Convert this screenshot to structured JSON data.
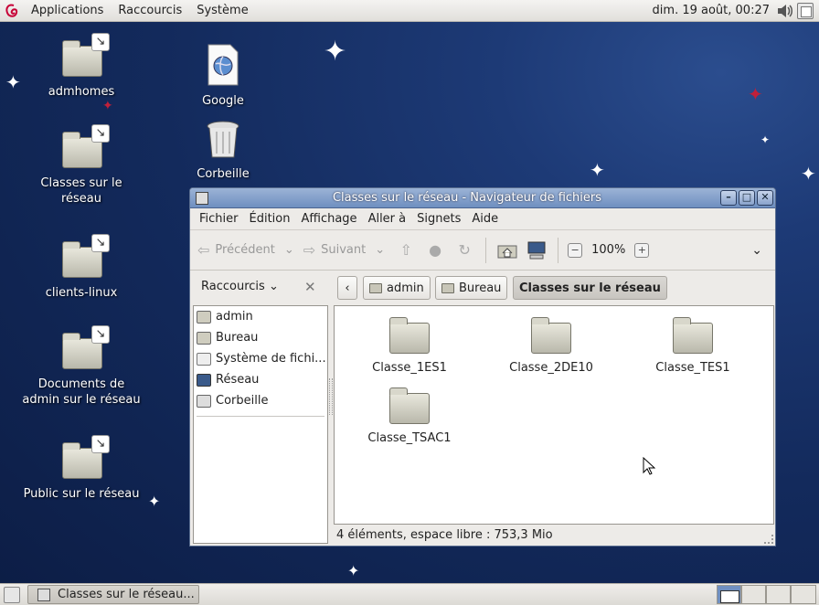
{
  "topbar": {
    "menus": [
      "Applications",
      "Raccourcis",
      "Système"
    ],
    "clock": "dim. 19 août, 00:27"
  },
  "desktop": {
    "icons": [
      {
        "label": "admhomes"
      },
      {
        "label": "Classes sur le réseau"
      },
      {
        "label": "clients-linux"
      },
      {
        "label": "Documents de admin sur le réseau"
      },
      {
        "label": "Public sur le réseau"
      },
      {
        "label": "Google"
      },
      {
        "label": "Corbeille"
      }
    ]
  },
  "window": {
    "title": "Classes sur le réseau - Navigateur de fichiers",
    "menus": [
      "Fichier",
      "Édition",
      "Affichage",
      "Aller à",
      "Signets",
      "Aide"
    ],
    "toolbar": {
      "back": "Précédent",
      "forward": "Suivant",
      "zoom": "100%"
    },
    "sidebar": {
      "combo": "Raccourcis",
      "items": [
        {
          "label": "admin",
          "icon": "home-folder-icon"
        },
        {
          "label": "Bureau",
          "icon": "desktop-folder-icon"
        },
        {
          "label": "Système de fichi...",
          "icon": "filesystem-icon"
        },
        {
          "label": "Réseau",
          "icon": "network-icon"
        },
        {
          "label": "Corbeille",
          "icon": "trash-icon"
        }
      ]
    },
    "breadcrumbs": [
      "admin",
      "Bureau",
      "Classes sur le réseau"
    ],
    "files": [
      {
        "label": "Classe_1ES1"
      },
      {
        "label": "Classe_2DE10"
      },
      {
        "label": "Classe_TES1"
      },
      {
        "label": "Classe_TSAC1"
      }
    ],
    "status": "4 éléments, espace libre : 753,3 Mio"
  },
  "taskbar": {
    "task": "Classes sur le réseau..."
  },
  "colors": {
    "desktop_bg": "#1d3a76",
    "titlebar": "#6f8fc0"
  }
}
